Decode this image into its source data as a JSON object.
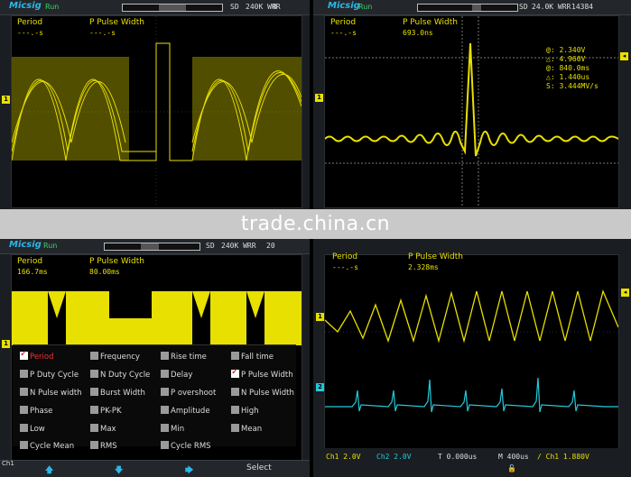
{
  "brand": {
    "logo": "Micsig",
    "run": "Run"
  },
  "panel1": {
    "sd": "SD",
    "mem": "240K WRR",
    "count": "0",
    "m1_label": "Period",
    "m1_value": "---.-s",
    "m2_label": "P Pulse Width",
    "m2_value": "---.-s"
  },
  "panel2": {
    "sd": "SD",
    "mem": "24.0K WRR",
    "count": "14384",
    "m1_label": "Period",
    "m1_value": "---.-s",
    "m2_label": "P Pulse Width",
    "m2_value": "693.0ns",
    "cursors": [
      "@: 2.340V",
      "△: 4.960V",
      "@: 840.0ms",
      "△: 1.440us",
      "S: 3.444MV/s"
    ]
  },
  "panel3": {
    "sd": "SD",
    "mem": "240K WRR",
    "count": "20",
    "m1_label": "Period",
    "m1_value": "166.7ms",
    "m2_label": "P Pulse Width",
    "m2_value": "80.00ms",
    "menu_rows": [
      [
        "Period",
        "Frequency",
        "Rise time",
        "Fall time"
      ],
      [
        "P Duty Cycle",
        "N Duty Cycle",
        "Delay",
        "P Pulse Width"
      ],
      [
        "N Pulse width",
        "Burst Width",
        "P overshoot",
        "N Pulse Width"
      ],
      [
        "Phase",
        "PK-PK",
        "Amplitude",
        "High"
      ],
      [
        "Low",
        "Max",
        "Min",
        "Mean"
      ],
      [
        "Cycle Mean",
        "RMS",
        "Cycle RMS",
        ""
      ]
    ],
    "softkeys": {
      "ch": "Ch1",
      "select": "Select"
    }
  },
  "panel4": {
    "m1_label": "Period",
    "m1_value": "---.-s",
    "m2_label": "P Pulse Width",
    "m2_value": "2.328ms",
    "ch1": "Ch1 2.0V",
    "ch2": "Ch2 2.0V",
    "trig": "T  0.000us",
    "timebase": "M  400us",
    "trig_level": "/ Ch1  1.880V"
  },
  "watermark": "trade.china.cn",
  "colors": {
    "ch1": "#e8e000",
    "ch2": "#25c9d9",
    "accent": "#2ab7ea"
  }
}
